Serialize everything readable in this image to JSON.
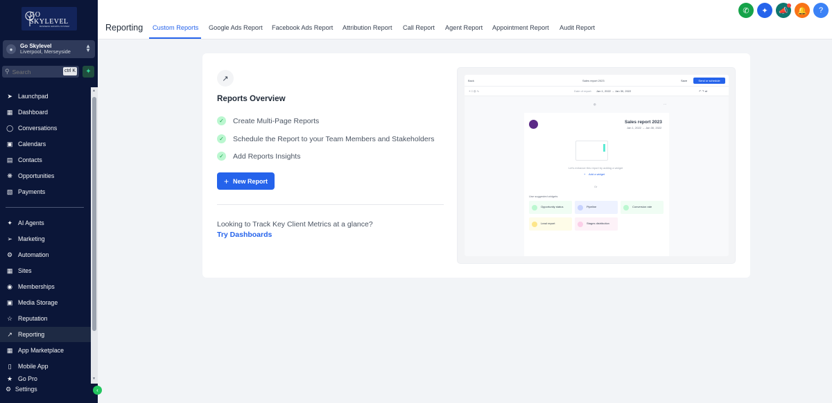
{
  "brand": {
    "logo_text": "GO SKYLEVEL",
    "logo_sub": "BUSINESS GROWTH SYSTEM"
  },
  "account": {
    "name": "Go Skylevel",
    "location": "Liverpool, Merseyside"
  },
  "search": {
    "placeholder": "Search",
    "shortcut": "ctrl K"
  },
  "nav": [
    {
      "label": "Launchpad",
      "icon": "rocket-icon"
    },
    {
      "label": "Dashboard",
      "icon": "grid-icon"
    },
    {
      "label": "Conversations",
      "icon": "chat-icon"
    },
    {
      "label": "Calendars",
      "icon": "calendar-icon"
    },
    {
      "label": "Contacts",
      "icon": "contacts-icon"
    },
    {
      "label": "Opportunities",
      "icon": "opportunities-icon"
    },
    {
      "label": "Payments",
      "icon": "payments-icon"
    },
    {
      "label": "AI Agents",
      "icon": "sparkle-icon"
    },
    {
      "label": "Marketing",
      "icon": "send-icon"
    },
    {
      "label": "Automation",
      "icon": "automation-icon"
    },
    {
      "label": "Sites",
      "icon": "sites-icon"
    },
    {
      "label": "Memberships",
      "icon": "award-icon"
    },
    {
      "label": "Media Storage",
      "icon": "image-icon"
    },
    {
      "label": "Reputation",
      "icon": "star-icon"
    },
    {
      "label": "Reporting",
      "icon": "trend-icon"
    },
    {
      "label": "App Marketplace",
      "icon": "apps-icon"
    },
    {
      "label": "Mobile App",
      "icon": "mobile-icon"
    }
  ],
  "nav_partial": "Go Pro",
  "settings_label": "Settings",
  "header": {
    "title": "Reporting",
    "tabs": [
      "Custom Reports",
      "Google Ads Report",
      "Facebook Ads Report",
      "Attribution Report",
      "Call Report",
      "Agent Report",
      "Appointment Report",
      "Audit Report"
    ]
  },
  "card": {
    "title": "Reports Overview",
    "features": [
      "Create Multi-Page Reports",
      "Schedule the Report to your Team Members and Stakeholders",
      "Add Reports Insights"
    ],
    "new_report": "New Report",
    "track_text": "Looking to Track Key Client Metrics at a glance?",
    "try_link": "Try Dashboards"
  },
  "preview": {
    "back": "Back",
    "title": "Sales report 2023",
    "save": "Save",
    "send": "Send or schedule",
    "date_label": "Date of report:",
    "date_range": "Jan 1, 2022 → Jan 30, 2022",
    "report_title": "Sales report 2023",
    "report_date": "Jan 1, 2022 → Jan 30, 2022",
    "enhance": "Let's enhance this report by adding a widget",
    "add_widget": "Add a widget",
    "or": "Or",
    "suggested": "Use suggested widgets",
    "widgets": [
      "Opportunity status",
      "Pipeline",
      "Conversion rate",
      "Lead report",
      "Stages distribution"
    ]
  },
  "colors": {
    "sidebar": "#0b1638",
    "accent": "#2563eb",
    "success": "#16a34a"
  }
}
